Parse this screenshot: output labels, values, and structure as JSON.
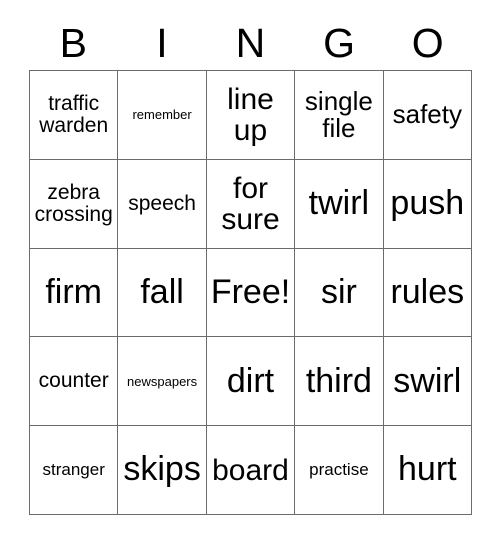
{
  "card": {
    "title": "BINGO",
    "header_letters": [
      "B",
      "I",
      "N",
      "G",
      "O"
    ],
    "rows": [
      [
        {
          "text": "traffic warden",
          "size": "fs-m"
        },
        {
          "text": "remember",
          "size": "fs-xs"
        },
        {
          "text": "line up",
          "size": "fs-xl"
        },
        {
          "text": "single file",
          "size": "fs-l"
        },
        {
          "text": "safety",
          "size": "fs-l"
        }
      ],
      [
        {
          "text": "zebra crossing",
          "size": "fs-m"
        },
        {
          "text": "speech",
          "size": "fs-m"
        },
        {
          "text": "for sure",
          "size": "fs-xl"
        },
        {
          "text": "twirl",
          "size": "fs-xxl"
        },
        {
          "text": "push",
          "size": "fs-xxl"
        }
      ],
      [
        {
          "text": "firm",
          "size": "fs-xxl"
        },
        {
          "text": "fall",
          "size": "fs-xxl"
        },
        {
          "text": "Free!",
          "size": "fs-xxl"
        },
        {
          "text": "sir",
          "size": "fs-xxl"
        },
        {
          "text": "rules",
          "size": "fs-xxl"
        }
      ],
      [
        {
          "text": "counter",
          "size": "fs-m"
        },
        {
          "text": "newspapers",
          "size": "fs-xs"
        },
        {
          "text": "dirt",
          "size": "fs-xxl"
        },
        {
          "text": "third",
          "size": "fs-xxl"
        },
        {
          "text": "swirl",
          "size": "fs-xxl"
        }
      ],
      [
        {
          "text": "stranger",
          "size": "fs-s"
        },
        {
          "text": "skips",
          "size": "fs-xxl"
        },
        {
          "text": "board",
          "size": "fs-xl"
        },
        {
          "text": "practise",
          "size": "fs-s"
        },
        {
          "text": "hurt",
          "size": "fs-xxl"
        }
      ]
    ],
    "free_space_label": "Free!",
    "colors": {
      "background": "#ffffff",
      "text": "#000000",
      "grid_line": "#6b6b6b"
    }
  }
}
